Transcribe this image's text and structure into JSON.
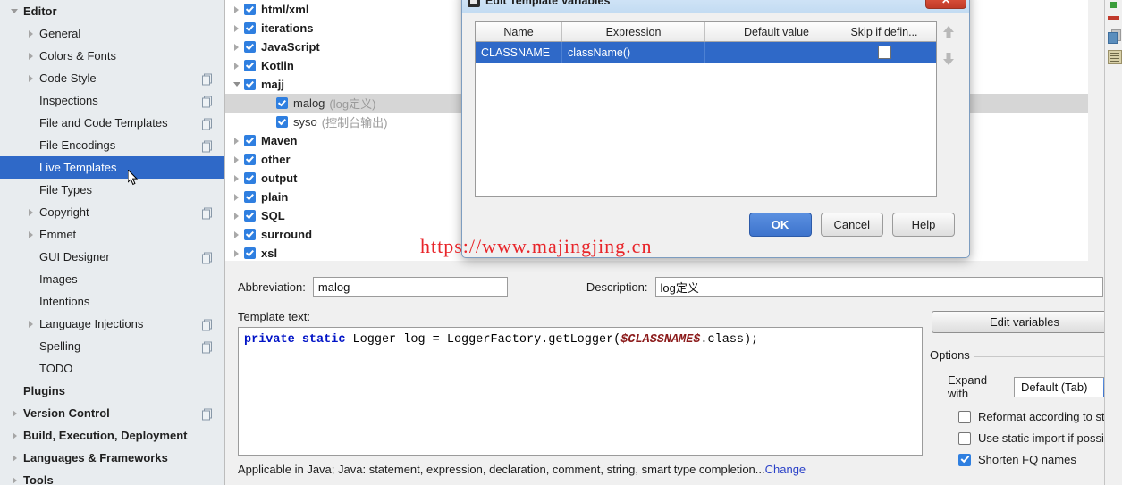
{
  "sidebar": {
    "items": [
      {
        "label": "Editor",
        "level": 0,
        "bold": true,
        "twisty": "down",
        "copy": false,
        "selected": false
      },
      {
        "label": "General",
        "level": 1,
        "bold": false,
        "twisty": "right",
        "copy": false,
        "selected": false
      },
      {
        "label": "Colors & Fonts",
        "level": 1,
        "bold": false,
        "twisty": "right",
        "copy": false,
        "selected": false
      },
      {
        "label": "Code Style",
        "level": 1,
        "bold": false,
        "twisty": "right",
        "copy": true,
        "selected": false
      },
      {
        "label": "Inspections",
        "level": 1,
        "bold": false,
        "twisty": "none",
        "copy": true,
        "selected": false
      },
      {
        "label": "File and Code Templates",
        "level": 1,
        "bold": false,
        "twisty": "none",
        "copy": true,
        "selected": false
      },
      {
        "label": "File Encodings",
        "level": 1,
        "bold": false,
        "twisty": "none",
        "copy": true,
        "selected": false
      },
      {
        "label": "Live Templates",
        "level": 1,
        "bold": false,
        "twisty": "none",
        "copy": false,
        "selected": true
      },
      {
        "label": "File Types",
        "level": 1,
        "bold": false,
        "twisty": "none",
        "copy": false,
        "selected": false
      },
      {
        "label": "Copyright",
        "level": 1,
        "bold": false,
        "twisty": "right",
        "copy": true,
        "selected": false
      },
      {
        "label": "Emmet",
        "level": 1,
        "bold": false,
        "twisty": "right",
        "copy": false,
        "selected": false
      },
      {
        "label": "GUI Designer",
        "level": 1,
        "bold": false,
        "twisty": "none",
        "copy": true,
        "selected": false
      },
      {
        "label": "Images",
        "level": 1,
        "bold": false,
        "twisty": "none",
        "copy": false,
        "selected": false
      },
      {
        "label": "Intentions",
        "level": 1,
        "bold": false,
        "twisty": "none",
        "copy": false,
        "selected": false
      },
      {
        "label": "Language Injections",
        "level": 1,
        "bold": false,
        "twisty": "right",
        "copy": true,
        "selected": false
      },
      {
        "label": "Spelling",
        "level": 1,
        "bold": false,
        "twisty": "none",
        "copy": true,
        "selected": false
      },
      {
        "label": "TODO",
        "level": 1,
        "bold": false,
        "twisty": "none",
        "copy": false,
        "selected": false
      },
      {
        "label": "Plugins",
        "level": 0,
        "bold": true,
        "twisty": "none",
        "copy": false,
        "selected": false
      },
      {
        "label": "Version Control",
        "level": 0,
        "bold": true,
        "twisty": "right",
        "copy": true,
        "selected": false
      },
      {
        "label": "Build, Execution, Deployment",
        "level": 0,
        "bold": true,
        "twisty": "right",
        "copy": false,
        "selected": false
      },
      {
        "label": "Languages & Frameworks",
        "level": 0,
        "bold": true,
        "twisty": "right",
        "copy": false,
        "selected": false
      },
      {
        "label": "Tools",
        "level": 0,
        "bold": true,
        "twisty": "right",
        "copy": false,
        "selected": false
      }
    ]
  },
  "template_tree": {
    "items": [
      {
        "name": "html/xml",
        "desc": "",
        "level": 1,
        "twisty": "right",
        "checked": true,
        "bold": true,
        "highlight": false
      },
      {
        "name": "iterations",
        "desc": "",
        "level": 1,
        "twisty": "right",
        "checked": true,
        "bold": true,
        "highlight": false
      },
      {
        "name": "JavaScript",
        "desc": "",
        "level": 1,
        "twisty": "right",
        "checked": true,
        "bold": true,
        "highlight": false
      },
      {
        "name": "Kotlin",
        "desc": "",
        "level": 1,
        "twisty": "right",
        "checked": true,
        "bold": true,
        "highlight": false
      },
      {
        "name": "majj",
        "desc": "",
        "level": 1,
        "twisty": "down",
        "checked": true,
        "bold": true,
        "highlight": false
      },
      {
        "name": "malog",
        "desc": "(log定义)",
        "level": 2,
        "twisty": "none",
        "checked": true,
        "bold": false,
        "highlight": true
      },
      {
        "name": "syso",
        "desc": "(控制台输出)",
        "level": 2,
        "twisty": "none",
        "checked": true,
        "bold": false,
        "highlight": false
      },
      {
        "name": "Maven",
        "desc": "",
        "level": 1,
        "twisty": "right",
        "checked": true,
        "bold": true,
        "highlight": false
      },
      {
        "name": "other",
        "desc": "",
        "level": 1,
        "twisty": "right",
        "checked": true,
        "bold": true,
        "highlight": false
      },
      {
        "name": "output",
        "desc": "",
        "level": 1,
        "twisty": "right",
        "checked": true,
        "bold": true,
        "highlight": false
      },
      {
        "name": "plain",
        "desc": "",
        "level": 1,
        "twisty": "right",
        "checked": true,
        "bold": true,
        "highlight": false
      },
      {
        "name": "SQL",
        "desc": "",
        "level": 1,
        "twisty": "right",
        "checked": true,
        "bold": true,
        "highlight": false
      },
      {
        "name": "surround",
        "desc": "",
        "level": 1,
        "twisty": "right",
        "checked": true,
        "bold": true,
        "highlight": false
      },
      {
        "name": "xsl",
        "desc": "",
        "level": 1,
        "twisty": "right",
        "checked": true,
        "bold": true,
        "highlight": false
      }
    ]
  },
  "dialog": {
    "title": "Edit Template Variables",
    "close_label": "✕",
    "columns": [
      "Name",
      "Expression",
      "Default value",
      "Skip if defin..."
    ],
    "rows": [
      {
        "name": "CLASSNAME",
        "expression": "className()",
        "default_value": "",
        "skip_if_defined": false
      }
    ],
    "buttons": {
      "ok": "OK",
      "cancel": "Cancel",
      "help": "Help"
    }
  },
  "form": {
    "abbreviation_label": "Abbreviation:",
    "abbreviation_value": "malog",
    "description_label": "Description:",
    "description_value": "log定义",
    "template_text_label": "Template text:",
    "code": {
      "tokens": [
        {
          "text": "private",
          "type": "keyword"
        },
        {
          "text": " ",
          "type": "plain"
        },
        {
          "text": "static",
          "type": "keyword"
        },
        {
          "text": " Logger log = LoggerFactory.getLogger(",
          "type": "plain"
        },
        {
          "text": "$CLASSNAME$",
          "type": "variable"
        },
        {
          "text": ".class);",
          "type": "plain"
        }
      ]
    },
    "applicable_text": "Applicable in Java; Java: statement, expression, declaration, comment, string, smart type completion...",
    "change_link": "Change"
  },
  "options": {
    "edit_variables_button": "Edit variables",
    "legend": "Options",
    "expand_with_label": "Expand with",
    "expand_with_value": "Default (Tab)",
    "checkboxes": [
      {
        "label": "Reformat according to style",
        "checked": false
      },
      {
        "label": "Use static import if possible",
        "checked": false
      },
      {
        "label": "Shorten FQ names",
        "checked": true
      }
    ]
  },
  "watermark": "https://www.majingjing.cn"
}
